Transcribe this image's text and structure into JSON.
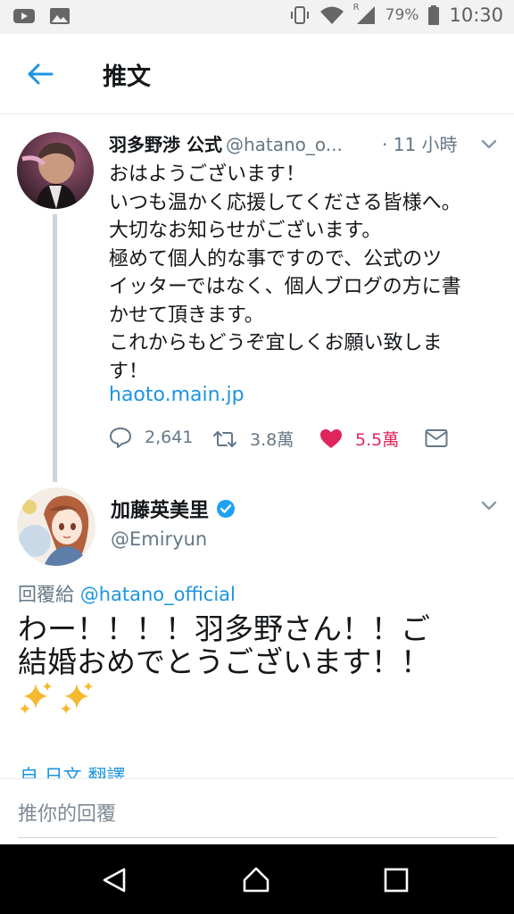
{
  "status_bar": {
    "icons_left": [
      "youtube-icon",
      "gallery-icon"
    ],
    "icons_right": [
      "vibrate-icon",
      "wifi-icon",
      "signal-icon",
      "battery-icon"
    ],
    "roaming_label": "R",
    "battery": "79%",
    "time": "10:30"
  },
  "header": {
    "title": "推文"
  },
  "tweet1": {
    "name": "羽多野渉 公式",
    "handle": "@hatano_o...",
    "time": "· 11 小時",
    "lines": [
      "おはようございます！",
      "いつも温かく応援してくださる皆様へ。",
      "大切なお知らせがございます。",
      "極めて個人的な事ですので、公式のツ",
      "イッターではなく、個人ブログの方に書",
      "かせて頂きます。",
      "これからもどうぞ宜しくお願い致しま",
      "す！"
    ],
    "link": "haoto.main.jp",
    "actions": {
      "replies": "2,641",
      "retweets": "3.8萬",
      "likes": "5.5萬"
    },
    "colors": {
      "like": "#e0245e",
      "link": "#1b95e0",
      "muted": "#657786"
    }
  },
  "tweet2": {
    "name": "加藤英美里",
    "handle": "@Emiryun",
    "verified": true,
    "reply_prefix": "回覆給",
    "reply_mention": "@hatano_official",
    "lines": [
      "わー！！！！羽多野さん！！ご",
      "結婚おめでとうございます！！"
    ],
    "emoji": [
      "sparkles-icon",
      "sparkles-icon"
    ],
    "translate_label": "自 日文 翻譯"
  },
  "reply_bar": {
    "placeholder": "推你的回覆"
  },
  "nav": {
    "buttons": [
      "back-icon",
      "home-icon",
      "recents-icon"
    ]
  }
}
